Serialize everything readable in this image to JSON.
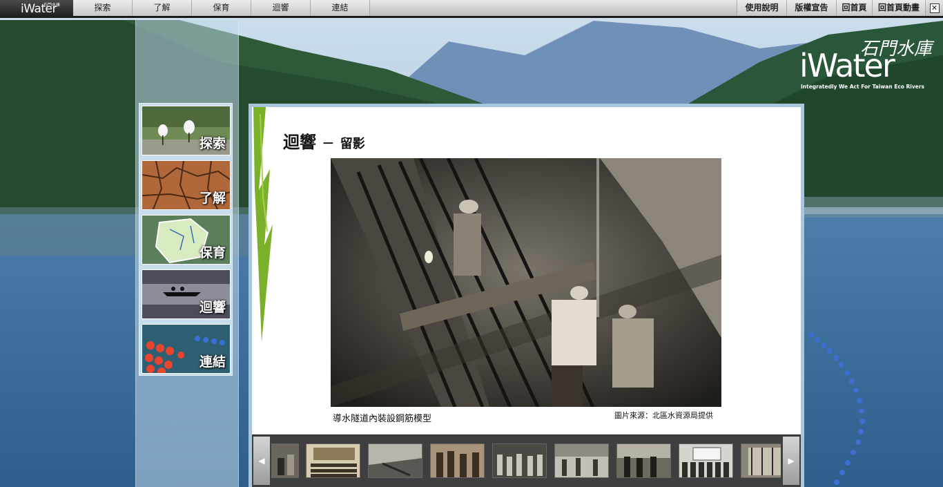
{
  "topbar": {
    "logo_text": "iWater",
    "logo_chinese": "石門水庫",
    "nav_left": [
      {
        "label": "探索"
      },
      {
        "label": "了解"
      },
      {
        "label": "保育"
      },
      {
        "label": "迴響"
      },
      {
        "label": "連結"
      }
    ],
    "nav_right": [
      {
        "label": "使用說明"
      },
      {
        "label": "版權宣告"
      },
      {
        "label": "回首頁"
      },
      {
        "label": "回首頁動畫"
      }
    ],
    "close_label": "✕"
  },
  "brand": {
    "wordmark": "iWater",
    "chinese": "石門水庫",
    "tagline": "Integratedly We Act For Taiwan Eco Rivers"
  },
  "sidebar": {
    "items": [
      {
        "label": "探索",
        "icon": "egrets-photo"
      },
      {
        "label": "了解",
        "icon": "cracked-earth-photo"
      },
      {
        "label": "保育",
        "icon": "map-photo"
      },
      {
        "label": "迴響",
        "icon": "boat-photo"
      },
      {
        "label": "連結",
        "icon": "buoys-photo"
      }
    ]
  },
  "content": {
    "title": "迴響",
    "dash": "－",
    "subtitle": "留影",
    "caption": "導水隧道內裝設鋼筋模型",
    "credit": "圖片來源：北區水資源局提供"
  },
  "gallery": {
    "prev_label": "◀",
    "next_label": "▶",
    "thumbnail_count": 9
  },
  "colors": {
    "topbar_bg": "#c9c9c9",
    "panel_border": "#a9c6dc",
    "strip_bg": "#3f3f3f"
  }
}
